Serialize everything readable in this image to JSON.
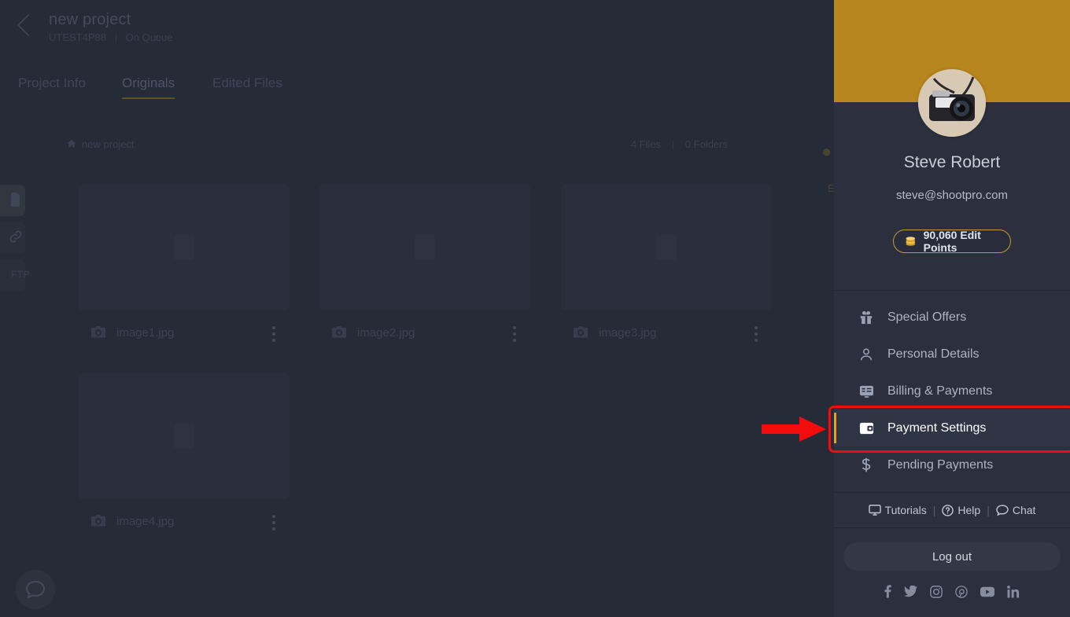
{
  "colors": {
    "page_bg": "#262b38",
    "panel_bg": "#2b2f3e",
    "panel_header_gold": "#b8861f",
    "accent_gold": "#e0a326",
    "annotation_red": "#f40c0c",
    "selected_item_bg": "#303545"
  },
  "project": {
    "back_icon": "chevron-left-icon",
    "title": "new project",
    "code": "UTEST4P88",
    "separator": "|",
    "status": "On Queue",
    "tabs": [
      {
        "label": "Project Info",
        "active": false
      },
      {
        "label": "Originals",
        "active": true
      },
      {
        "label": "Edited Files",
        "active": false
      }
    ],
    "breadcrumb": {
      "home_icon": "home-icon",
      "label": "new project"
    },
    "counts": {
      "files": "4 Files",
      "separator": "|",
      "folders": "0 Folders"
    }
  },
  "rail": [
    {
      "icon": "document-icon",
      "label": "",
      "active": true
    },
    {
      "icon": "link-icon",
      "label": "",
      "active": false
    },
    {
      "icon": "ftp-icon",
      "label": "FTP",
      "active": false
    }
  ],
  "files": [
    {
      "name": "image1.jpg",
      "icon": "camera-icon",
      "menu_icon": "more-vertical-icon"
    },
    {
      "name": "image2.jpg",
      "icon": "camera-icon",
      "menu_icon": "more-vertical-icon"
    },
    {
      "name": "image3.jpg",
      "icon": "camera-icon",
      "menu_icon": "more-vertical-icon"
    },
    {
      "name": "image4.jpg",
      "icon": "camera-icon",
      "menu_icon": "more-vertical-icon"
    }
  ],
  "chat_fab": {
    "icon": "chat-bubble-icon"
  },
  "account_panel": {
    "avatar": {
      "icon": "camera-photo-avatar",
      "alt": "vintage camera photo"
    },
    "user_name": "Steve Robert",
    "user_email": "steve@shootpro.com",
    "points_badge": {
      "icon": "coins-icon",
      "label": "90,060 Edit Points"
    },
    "menu": [
      {
        "icon": "gift-icon",
        "label": "Special Offers",
        "selected": false
      },
      {
        "icon": "person-icon",
        "label": "Personal Details",
        "selected": false
      },
      {
        "icon": "billing-card-icon",
        "label": "Billing & Payments",
        "selected": false
      },
      {
        "icon": "wallet-icon",
        "label": "Payment Settings",
        "selected": true
      },
      {
        "icon": "dollar-icon",
        "label": "Pending Payments",
        "selected": false
      }
    ],
    "links": [
      {
        "icon": "monitor-icon",
        "label": "Tutorials"
      },
      {
        "icon": "question-circle-icon",
        "label": "Help"
      },
      {
        "icon": "chat-bubble-icon",
        "label": "Chat"
      }
    ],
    "link_separator": "|",
    "logout_label": "Log out",
    "social": [
      {
        "icon": "facebook-icon",
        "glyph": "f"
      },
      {
        "icon": "twitter-icon",
        "glyph": "t"
      },
      {
        "icon": "instagram-icon",
        "glyph": "ig"
      },
      {
        "icon": "pinterest-icon",
        "glyph": "p"
      },
      {
        "icon": "youtube-icon",
        "glyph": "yt"
      },
      {
        "icon": "linkedin-icon",
        "glyph": "in"
      }
    ]
  },
  "annotation": {
    "arrow_icon": "red-arrow-right",
    "highlight_target": "Payment Settings"
  }
}
